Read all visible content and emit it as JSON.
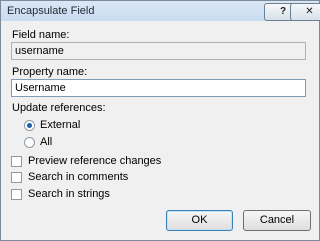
{
  "window": {
    "title": "Encapsulate Field"
  },
  "titlebar": {
    "help_label": "?",
    "close_label": "✕"
  },
  "field_name": {
    "label": "Field name:",
    "value": "username"
  },
  "property_name": {
    "label": "Property name:",
    "value": "Username"
  },
  "update_references": {
    "label": "Update references:",
    "options": [
      {
        "label": "External",
        "checked": true
      },
      {
        "label": "All",
        "checked": false
      }
    ]
  },
  "checkboxes": [
    {
      "label": "Preview reference changes",
      "checked": false
    },
    {
      "label": "Search in comments",
      "checked": false
    },
    {
      "label": "Search in strings",
      "checked": false
    }
  ],
  "buttons": {
    "ok_label": "OK",
    "cancel_label": "Cancel"
  }
}
